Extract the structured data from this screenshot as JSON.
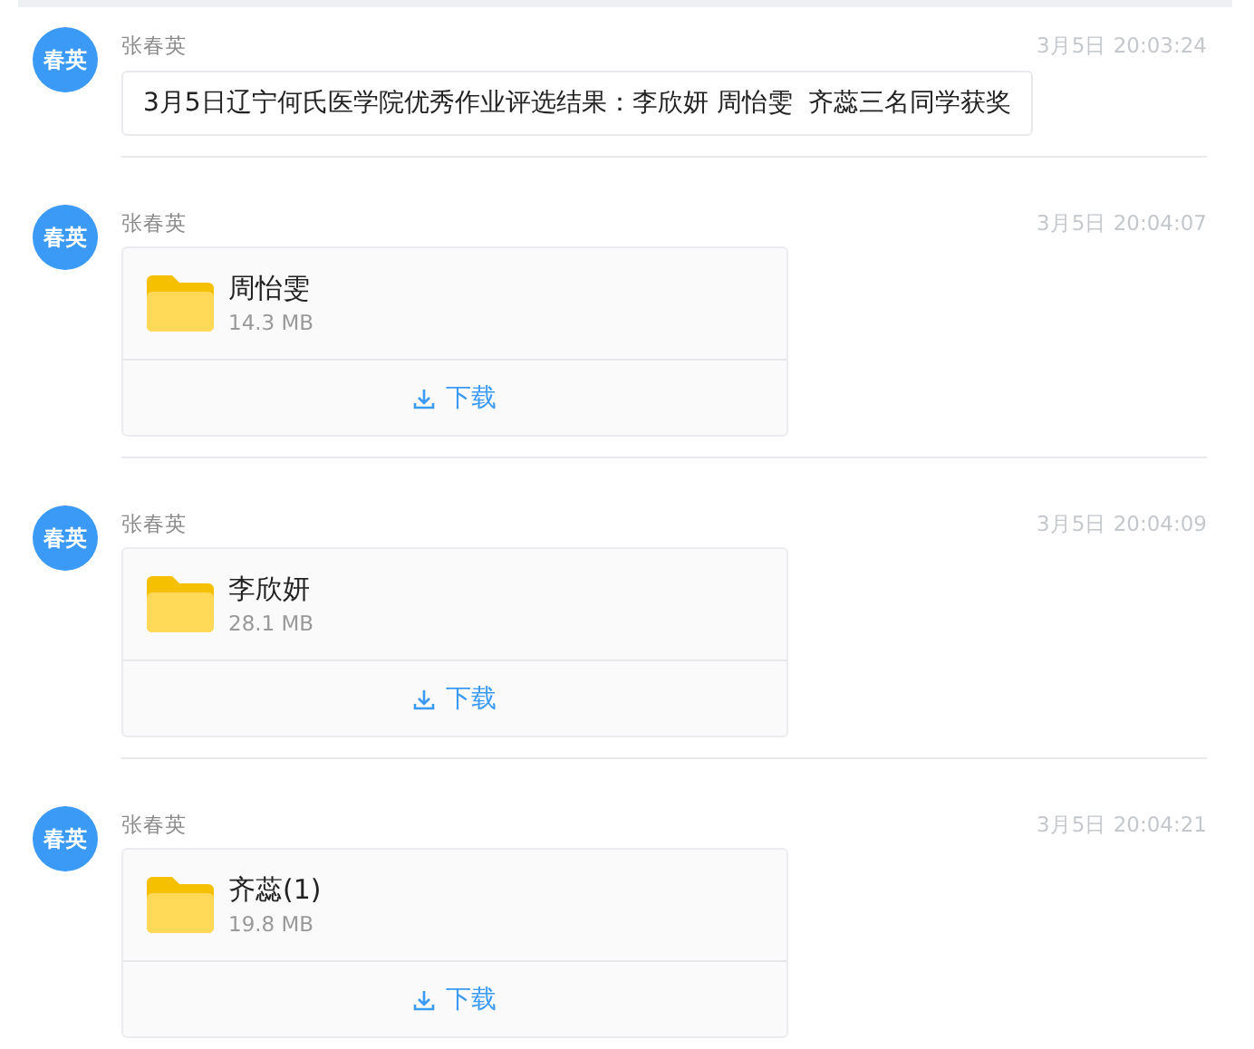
{
  "messages": [
    {
      "kind": "text",
      "avatar": "春英",
      "sender": "张春英",
      "time": "3月5日 20:03:24",
      "text": "3月5日辽宁何氏医学院优秀作业评选结果：李欣妍 周怡雯  齐蕊三名同学获奖"
    },
    {
      "kind": "file",
      "avatar": "春英",
      "sender": "张春英",
      "time": "3月5日 20:04:07",
      "file_name": "周怡雯",
      "file_size": "14.3 MB",
      "action": "下载"
    },
    {
      "kind": "file",
      "avatar": "春英",
      "sender": "张春英",
      "time": "3月5日 20:04:09",
      "file_name": "李欣妍",
      "file_size": "28.1 MB",
      "action": "下载"
    },
    {
      "kind": "file",
      "avatar": "春英",
      "sender": "张春英",
      "time": "3月5日 20:04:21",
      "file_name": "齐蕊(1)",
      "file_size": "19.8 MB",
      "action": "下载"
    }
  ]
}
